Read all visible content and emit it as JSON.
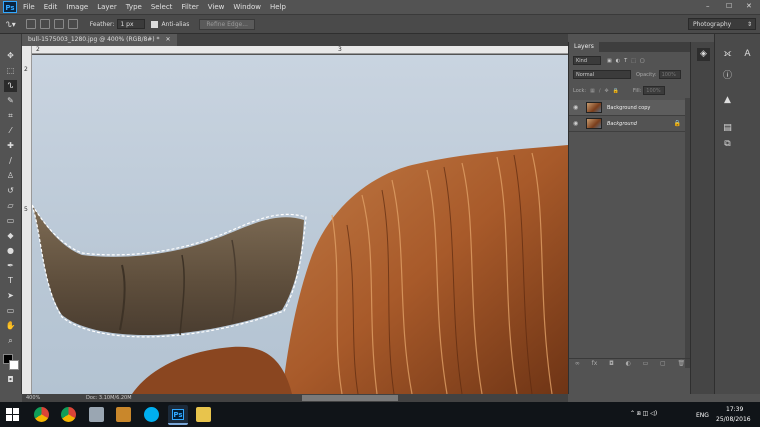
{
  "app": {
    "logo_text": "Ps"
  },
  "menu": {
    "items": [
      "File",
      "Edit",
      "Image",
      "Layer",
      "Type",
      "Select",
      "Filter",
      "View",
      "Window",
      "Help"
    ],
    "window_controls": {
      "minimize": "–",
      "maximize": "☐",
      "close": "✕"
    }
  },
  "options": {
    "feather_label": "Feather:",
    "feather_value": "1 px",
    "antialias_label": "Anti-alias",
    "refine_edge_label": "Refine Edge...",
    "workspace_value": "Photography"
  },
  "document": {
    "tab_title": "bull-1575003_1280.jpg @ 400% (RGB/8#) *",
    "ruler_h_marks": [
      "2",
      "3"
    ],
    "ruler_v_marks": [
      "2",
      "5"
    ]
  },
  "status": {
    "zoom": "400%",
    "doc_info": "Doc: 3.10M/6.20M"
  },
  "layers_panel": {
    "tab_label": "Layers",
    "kind_label": "Kind",
    "blend_mode": "Normal",
    "opacity_label": "Opacity:",
    "opacity_value": "100%",
    "lock_label": "Lock:",
    "fill_label": "Fill:",
    "fill_value": "100%",
    "layers": [
      {
        "name": "Background copy",
        "visible": true,
        "locked": false
      },
      {
        "name": "Background",
        "visible": true,
        "locked": true
      }
    ]
  },
  "taskbar": {
    "language": "ENG",
    "time": "17:39",
    "date": "25/08/2016"
  },
  "colors": {
    "accent_ps": "#31a8ff",
    "sky": "#c3cfdc",
    "fur": "#b5632e",
    "horn": "#6b5a45"
  }
}
